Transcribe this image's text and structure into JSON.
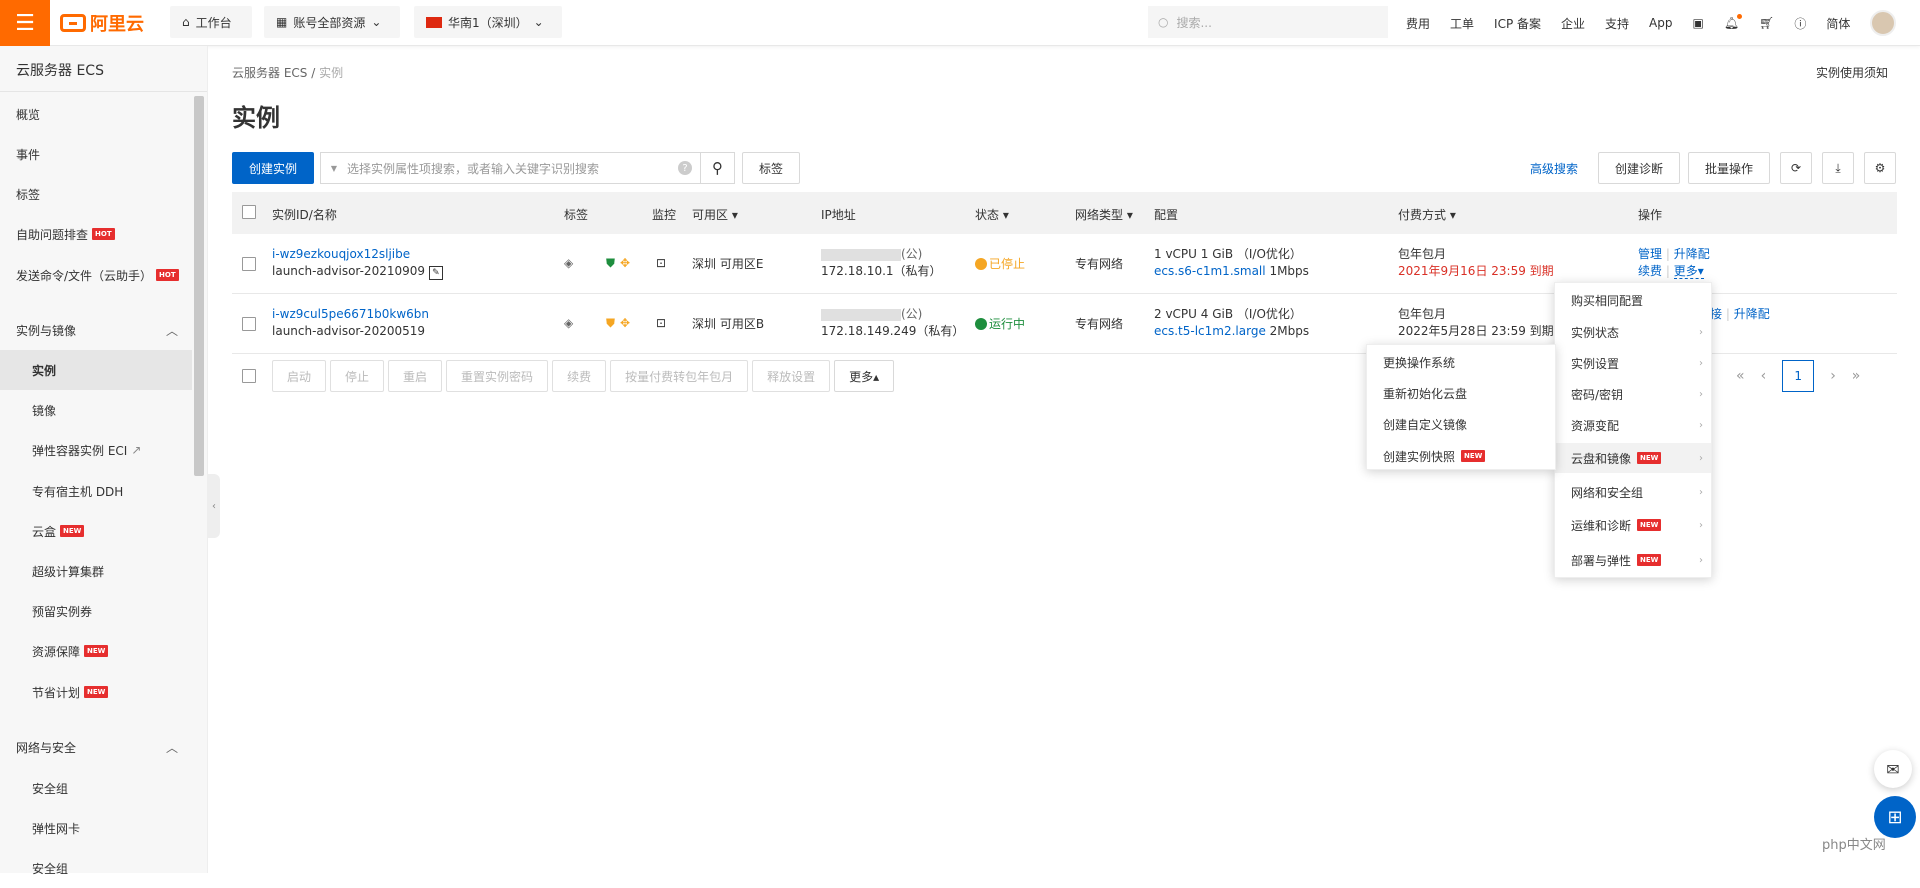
{
  "topbar": {
    "brand": "阿里云",
    "workbench": "工作台",
    "account_resources": "账号全部资源",
    "region": "华南1（深圳）",
    "search_placeholder": "搜索...",
    "links": [
      "费用",
      "工单",
      "ICP 备案",
      "企业",
      "支持",
      "App"
    ],
    "lang": "简体"
  },
  "sidebar": {
    "title": "云服务器 ECS",
    "items": [
      {
        "label": "概览"
      },
      {
        "label": "事件"
      },
      {
        "label": "标签"
      },
      {
        "label": "自助问题排查",
        "badge": "HOT"
      },
      {
        "label": "发送命令/文件（云助手）",
        "badge": "HOT"
      },
      {
        "label": "实例与镜像",
        "group": true
      },
      {
        "label": "实例",
        "active": true
      },
      {
        "label": "镜像"
      },
      {
        "label": "弹性容器实例 ECI"
      },
      {
        "label": "专有宿主机 DDH"
      },
      {
        "label": "云盒",
        "badge": "NEW"
      },
      {
        "label": "超级计算集群"
      },
      {
        "label": "预留实例券"
      },
      {
        "label": "资源保障",
        "badge": "NEW"
      },
      {
        "label": "节省计划",
        "badge": "NEW"
      },
      {
        "label": "网络与安全",
        "group": true
      },
      {
        "label": "安全组"
      },
      {
        "label": "弹性网卡"
      },
      {
        "label": "安全组"
      }
    ]
  },
  "breadcrumb": {
    "root": "云服务器 ECS",
    "sep": "/",
    "current": "实例"
  },
  "notice_link": "实例使用须知",
  "page_title": "实例",
  "toolbar": {
    "create": "创建实例",
    "search_placeholder": "选择实例属性项搜索，或者输入关键字识别搜索",
    "tag": "标签",
    "advanced": "高级搜索",
    "diagnose": "创建诊断",
    "batch": "批量操作"
  },
  "table": {
    "headers": {
      "id": "实例ID/名称",
      "tag": "标签",
      "monitor": "监控",
      "zone": "可用区",
      "ip": "IP地址",
      "status": "状态",
      "network": "网络类型",
      "config": "配置",
      "billing": "付费方式",
      "ops": "操作"
    },
    "rows": [
      {
        "id": "i-wz9ezkouqjox12sljibe",
        "name": "launch-advisor-20210909",
        "zone": "深圳 可用区E",
        "ip_public_suffix": "(公)",
        "ip_private": "172.18.10.1（私有）",
        "status": "已停止",
        "network": "专有网络",
        "config_line1": "1 vCPU 1 GiB （I/O优化）",
        "spec": "ecs.s6-c1m1.small",
        "bandwidth": "1Mbps",
        "billing": "包年包月",
        "expire": "2021年9月16日 23:59 到期",
        "op_manage": "管理",
        "op_upgrade": "升降配",
        "op_renew": "续费",
        "op_more": "更多"
      },
      {
        "id": "i-wz9cul5pe6671b0kw6bn",
        "name": "launch-advisor-20200519",
        "zone": "深圳 可用区B",
        "ip_public_suffix": "(公)",
        "ip_private": "172.18.149.249（私有）",
        "status": "运行中",
        "network": "专有网络",
        "config_line1": "2 vCPU 4 GiB （I/O优化）",
        "spec": "ecs.t5-lc1m2.large",
        "bandwidth": "2Mbps",
        "billing": "包年包月",
        "expire": "2022年5月28日 23:59 到期",
        "op_connect": "接",
        "op_upgrade": "升降配"
      }
    ]
  },
  "bulk_actions": [
    "启动",
    "停止",
    "重启",
    "重置实例密码",
    "续费",
    "按量付费转包年包月",
    "释放设置"
  ],
  "bulk_more": "更多▴",
  "pagination": {
    "current": "1"
  },
  "more_menu": {
    "items": [
      {
        "label": "购买相同配置"
      },
      {
        "label": "实例状态",
        "arrow": true
      },
      {
        "label": "实例设置",
        "arrow": true
      },
      {
        "label": "密码/密钥",
        "arrow": true
      },
      {
        "label": "资源变配",
        "arrow": true
      },
      {
        "label": "云盘和镜像",
        "arrow": true,
        "badge": "NEW",
        "highlight": true
      },
      {
        "label": "网络和安全组",
        "arrow": true
      },
      {
        "label": "运维和诊断",
        "arrow": true,
        "badge": "NEW"
      },
      {
        "label": "部署与弹性",
        "arrow": true,
        "badge": "NEW"
      }
    ]
  },
  "sub_menu": {
    "items": [
      {
        "label": "更换操作系统"
      },
      {
        "label": "重新初始化云盘"
      },
      {
        "label": "创建自定义镜像"
      },
      {
        "label": "创建实例快照",
        "badge": "NEW"
      }
    ]
  },
  "watermark": "php中文网",
  "colors": {
    "brand": "#ff6a00",
    "primary": "#0064c8",
    "expire_red": "#d93026",
    "running_green": "#1e8e3e",
    "stopped_orange": "#f5a623"
  }
}
